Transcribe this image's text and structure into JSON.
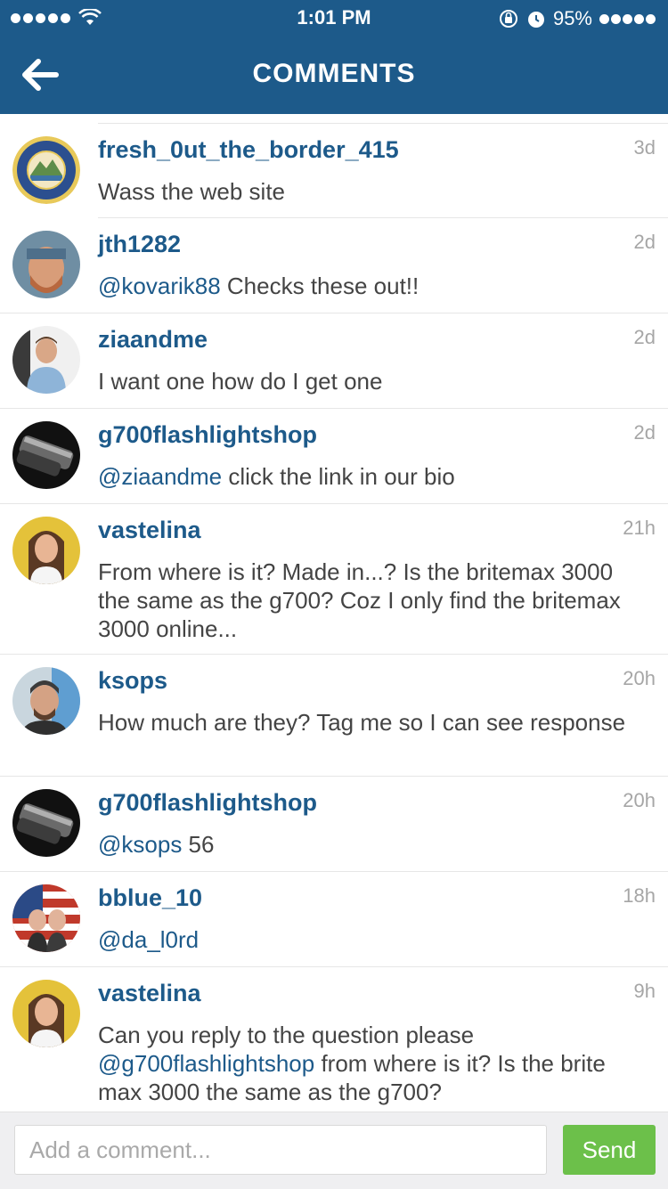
{
  "status_bar": {
    "time": "1:01 PM",
    "battery": "95%"
  },
  "header": {
    "title": "COMMENTS",
    "back_icon": "arrow-left-icon"
  },
  "colors": {
    "header_bg": "#1d5a8a",
    "username": "#1d5a8a",
    "send_bg": "#6cc04a"
  },
  "comments": [
    {
      "user": "fresh_0ut_the_border_415",
      "time": "3d",
      "parts": [
        {
          "t": "Wass the web site"
        }
      ]
    },
    {
      "user": "jth1282",
      "time": "2d",
      "parts": [
        {
          "t": "@kovarik88",
          "m": true
        },
        {
          "t": " Checks these out!!"
        }
      ]
    },
    {
      "user": "ziaandme",
      "time": "2d",
      "parts": [
        {
          "t": "I want one how do I get one"
        }
      ]
    },
    {
      "user": "g700flashlightshop",
      "time": "2d",
      "parts": [
        {
          "t": "@ziaandme",
          "m": true
        },
        {
          "t": " click the link in our bio"
        }
      ]
    },
    {
      "user": "vastelina",
      "time": "21h",
      "parts": [
        {
          "t": "From where is it? Made in...? Is the britemax 3000 the same as the g700? Coz I only find the britemax 3000 online..."
        }
      ]
    },
    {
      "user": "ksops",
      "time": "20h",
      "parts": [
        {
          "t": "How much are they? Tag me so I can see response"
        }
      ]
    },
    {
      "user": "g700flashlightshop",
      "time": "20h",
      "parts": [
        {
          "t": "@ksops",
          "m": true
        },
        {
          "t": " 56"
        }
      ]
    },
    {
      "user": "bblue_10",
      "time": "18h",
      "parts": [
        {
          "t": "@da_l0rd",
          "m": true
        }
      ]
    },
    {
      "user": "vastelina",
      "time": "9h",
      "parts": [
        {
          "t": "Can you reply to the question please "
        },
        {
          "t": "@g700flashlightshop",
          "m": true
        },
        {
          "t": " from where is it? Is the brite max 3000 the same as the g700?"
        }
      ]
    }
  ],
  "input": {
    "placeholder": "Add a comment...",
    "value": ""
  },
  "send_label": "Send"
}
